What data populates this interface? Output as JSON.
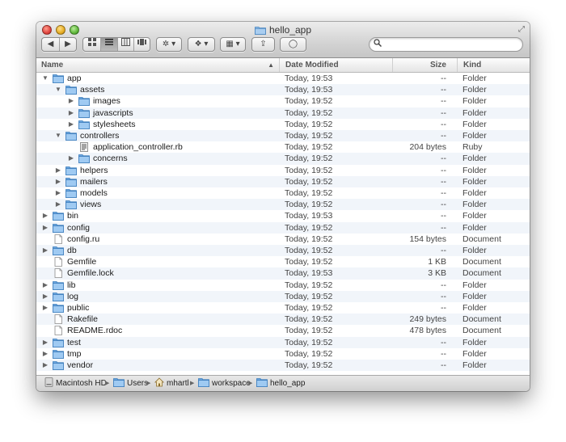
{
  "window": {
    "title": "hello_app"
  },
  "toolbar": {
    "back_label": "◀",
    "forward_label": "▶",
    "action_label": "✲ ▾",
    "dropbox_label": "❖ ▾",
    "arrange_label": "▦ ▾",
    "share_label": "⇪",
    "tag_label": "◯",
    "search_placeholder": ""
  },
  "columns": {
    "name": "Name",
    "date": "Date Modified",
    "size": "Size",
    "kind": "Kind"
  },
  "sort_indicator": "▲",
  "rows": [
    {
      "name": "app",
      "date": "Today, 19:53",
      "size": "--",
      "kind": "Folder"
    },
    {
      "name": "assets",
      "date": "Today, 19:53",
      "size": "--",
      "kind": "Folder"
    },
    {
      "name": "images",
      "date": "Today, 19:52",
      "size": "--",
      "kind": "Folder"
    },
    {
      "name": "javascripts",
      "date": "Today, 19:52",
      "size": "--",
      "kind": "Folder"
    },
    {
      "name": "stylesheets",
      "date": "Today, 19:52",
      "size": "--",
      "kind": "Folder"
    },
    {
      "name": "controllers",
      "date": "Today, 19:52",
      "size": "--",
      "kind": "Folder"
    },
    {
      "name": "application_controller.rb",
      "date": "Today, 19:52",
      "size": "204 bytes",
      "kind": "Ruby"
    },
    {
      "name": "concerns",
      "date": "Today, 19:52",
      "size": "--",
      "kind": "Folder"
    },
    {
      "name": "helpers",
      "date": "Today, 19:52",
      "size": "--",
      "kind": "Folder"
    },
    {
      "name": "mailers",
      "date": "Today, 19:52",
      "size": "--",
      "kind": "Folder"
    },
    {
      "name": "models",
      "date": "Today, 19:52",
      "size": "--",
      "kind": "Folder"
    },
    {
      "name": "views",
      "date": "Today, 19:52",
      "size": "--",
      "kind": "Folder"
    },
    {
      "name": "bin",
      "date": "Today, 19:53",
      "size": "--",
      "kind": "Folder"
    },
    {
      "name": "config",
      "date": "Today, 19:52",
      "size": "--",
      "kind": "Folder"
    },
    {
      "name": "config.ru",
      "date": "Today, 19:52",
      "size": "154 bytes",
      "kind": "Document"
    },
    {
      "name": "db",
      "date": "Today, 19:52",
      "size": "--",
      "kind": "Folder"
    },
    {
      "name": "Gemfile",
      "date": "Today, 19:52",
      "size": "1 KB",
      "kind": "Document"
    },
    {
      "name": "Gemfile.lock",
      "date": "Today, 19:53",
      "size": "3 KB",
      "kind": "Document"
    },
    {
      "name": "lib",
      "date": "Today, 19:52",
      "size": "--",
      "kind": "Folder"
    },
    {
      "name": "log",
      "date": "Today, 19:52",
      "size": "--",
      "kind": "Folder"
    },
    {
      "name": "public",
      "date": "Today, 19:52",
      "size": "--",
      "kind": "Folder"
    },
    {
      "name": "Rakefile",
      "date": "Today, 19:52",
      "size": "249 bytes",
      "kind": "Document"
    },
    {
      "name": "README.rdoc",
      "date": "Today, 19:52",
      "size": "478 bytes",
      "kind": "Document"
    },
    {
      "name": "test",
      "date": "Today, 19:52",
      "size": "--",
      "kind": "Folder"
    },
    {
      "name": "tmp",
      "date": "Today, 19:52",
      "size": "--",
      "kind": "Folder"
    },
    {
      "name": "vendor",
      "date": "Today, 19:52",
      "size": "--",
      "kind": "Folder"
    }
  ],
  "pathbar": {
    "items": [
      "Macintosh HD",
      "Users",
      "mhartl",
      "workspace",
      "hello_app"
    ]
  },
  "colors": {
    "folder": "#7fb3e6",
    "stripe": "#f1f5fa"
  }
}
